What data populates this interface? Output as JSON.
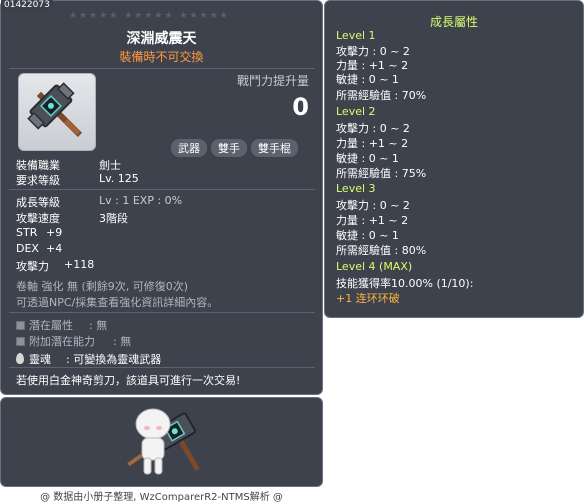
{
  "item_id": "01422073",
  "stars": "★★★★★ ★★★★★ ★★★★★",
  "item": {
    "name": "深淵威震天",
    "note": "裝備時不可交換",
    "power_label": "戰鬥力提升量",
    "power_value": "0",
    "tags": [
      "武器",
      "雙手",
      "雙手棍"
    ]
  },
  "requirements": [
    {
      "label": "裝備職業",
      "value": "劍士"
    },
    {
      "label": "要求等級",
      "value": "Lv. 125"
    }
  ],
  "stats": {
    "growth_label": "成長等級",
    "growth_value": "Lv  :  1   EXP  :  0%",
    "speed_label": "攻擊速度",
    "speed_value": "3階段",
    "str_label": "STR",
    "str_value": "+9",
    "dex_label": "DEX",
    "dex_value": "+4",
    "atk_label": "攻擊力",
    "atk_value": "+118"
  },
  "upgrade_info": {
    "line1": "卷軸 強化 無 (剩餘9次, 可修復0次)",
    "line2": "可透過NPC/採集查看強化資訊詳細內容。"
  },
  "potentials": {
    "potential_label": "潛在屬性",
    "potential_value": ":  無",
    "additional_label": "附加潛在能力",
    "additional_value": ":  無"
  },
  "soul": {
    "label": "靈魂",
    "value": ":  可變換為靈魂武器"
  },
  "trade_note": "若使用白金神奇剪刀，該道具可進行一次交易!",
  "footer": "@ 数据由小册子整理, WzComparerR2-NTMS解析 @",
  "growth": {
    "title": "成長屬性",
    "levels": [
      {
        "title": "Level 1",
        "lines": [
          "攻擊力 : 0 ~ 2",
          "力量 : +1 ~ 2",
          "敏捷 : 0 ~ 1",
          "所需經驗值 : 70%"
        ]
      },
      {
        "title": "Level 2",
        "lines": [
          "攻擊力 : 0 ~ 2",
          "力量 : +1 ~ 2",
          "敏捷 : 0 ~ 1",
          "所需經驗值 : 75%"
        ]
      },
      {
        "title": "Level 3",
        "lines": [
          "攻擊力 : 0 ~ 2",
          "力量 : +1 ~ 2",
          "敏捷 : 0 ~ 1",
          "所需經驗值 : 80%"
        ]
      }
    ],
    "max_title": "Level 4 (MAX)",
    "max_line": "技能獲得率10.00% (1/10):",
    "skill": "+1 连环环破"
  },
  "colors": {
    "panel_bg": "#3d424c",
    "level_green": "#d7ff6e",
    "note_orange": "#ff9a3c",
    "skill_orange": "#ffb340"
  },
  "icons": {
    "item": "warhammer-icon",
    "check": "checkbox-icon",
    "soul": "flame-icon",
    "character": "character-preview"
  }
}
